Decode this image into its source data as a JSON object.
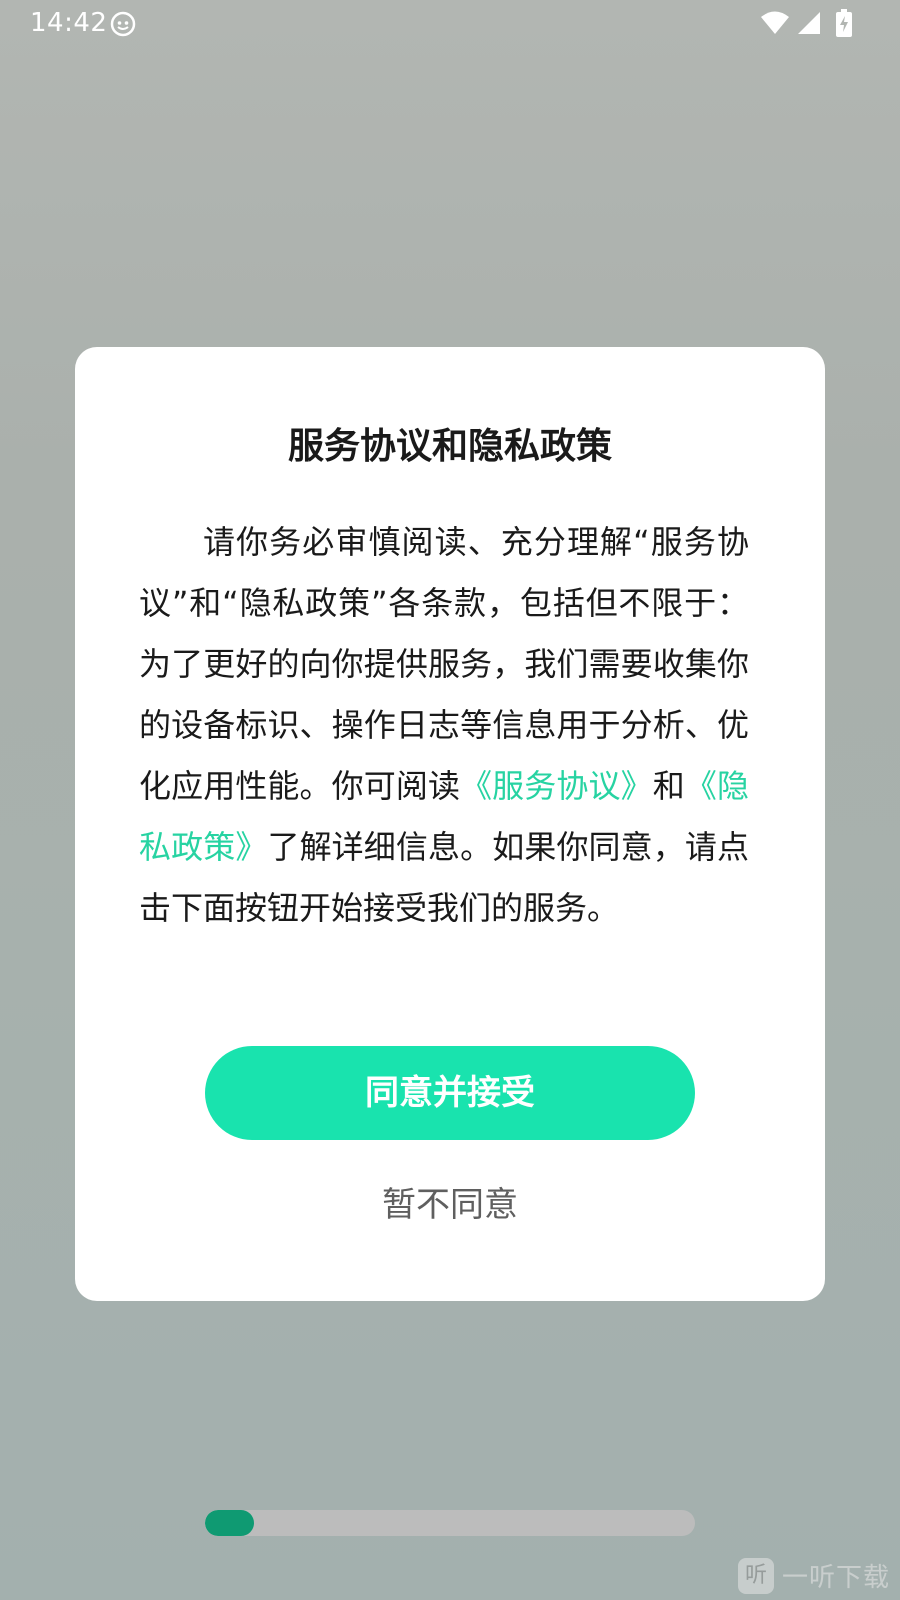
{
  "status_bar": {
    "time": "14:42",
    "icons": [
      "app-notification-icon",
      "wifi-icon",
      "cellular-signal-icon",
      "battery-charging-icon"
    ]
  },
  "dialog": {
    "title": "服务协议和隐私政策",
    "body_intro": "请你务必审慎阅读、充分理解“服务协议”和“隐私政策”各条款，包括但不限于：为了更好的向你提供服务，我们需要收集你的设备标识、操作日志等信息用于分析、优化应用性能。你可阅读",
    "service_agreement_link": "《服务协议》",
    "and_text": "和",
    "privacy_policy_link": "《隐私政策》",
    "body_outro": "了解详细信息。如果你同意，请点击下面按钮开始接受我们的服务。",
    "agree_button": "同意并接受",
    "decline_button": "暂不同意"
  },
  "progress": {
    "fraction": 0.1
  },
  "watermark": {
    "logo_char": "听",
    "text": "一听下载"
  },
  "colors": {
    "accent": "#19e3ae",
    "link": "#27d3a2",
    "progress_fill": "#0f9a72",
    "progress_track": "#bcbcbc"
  }
}
